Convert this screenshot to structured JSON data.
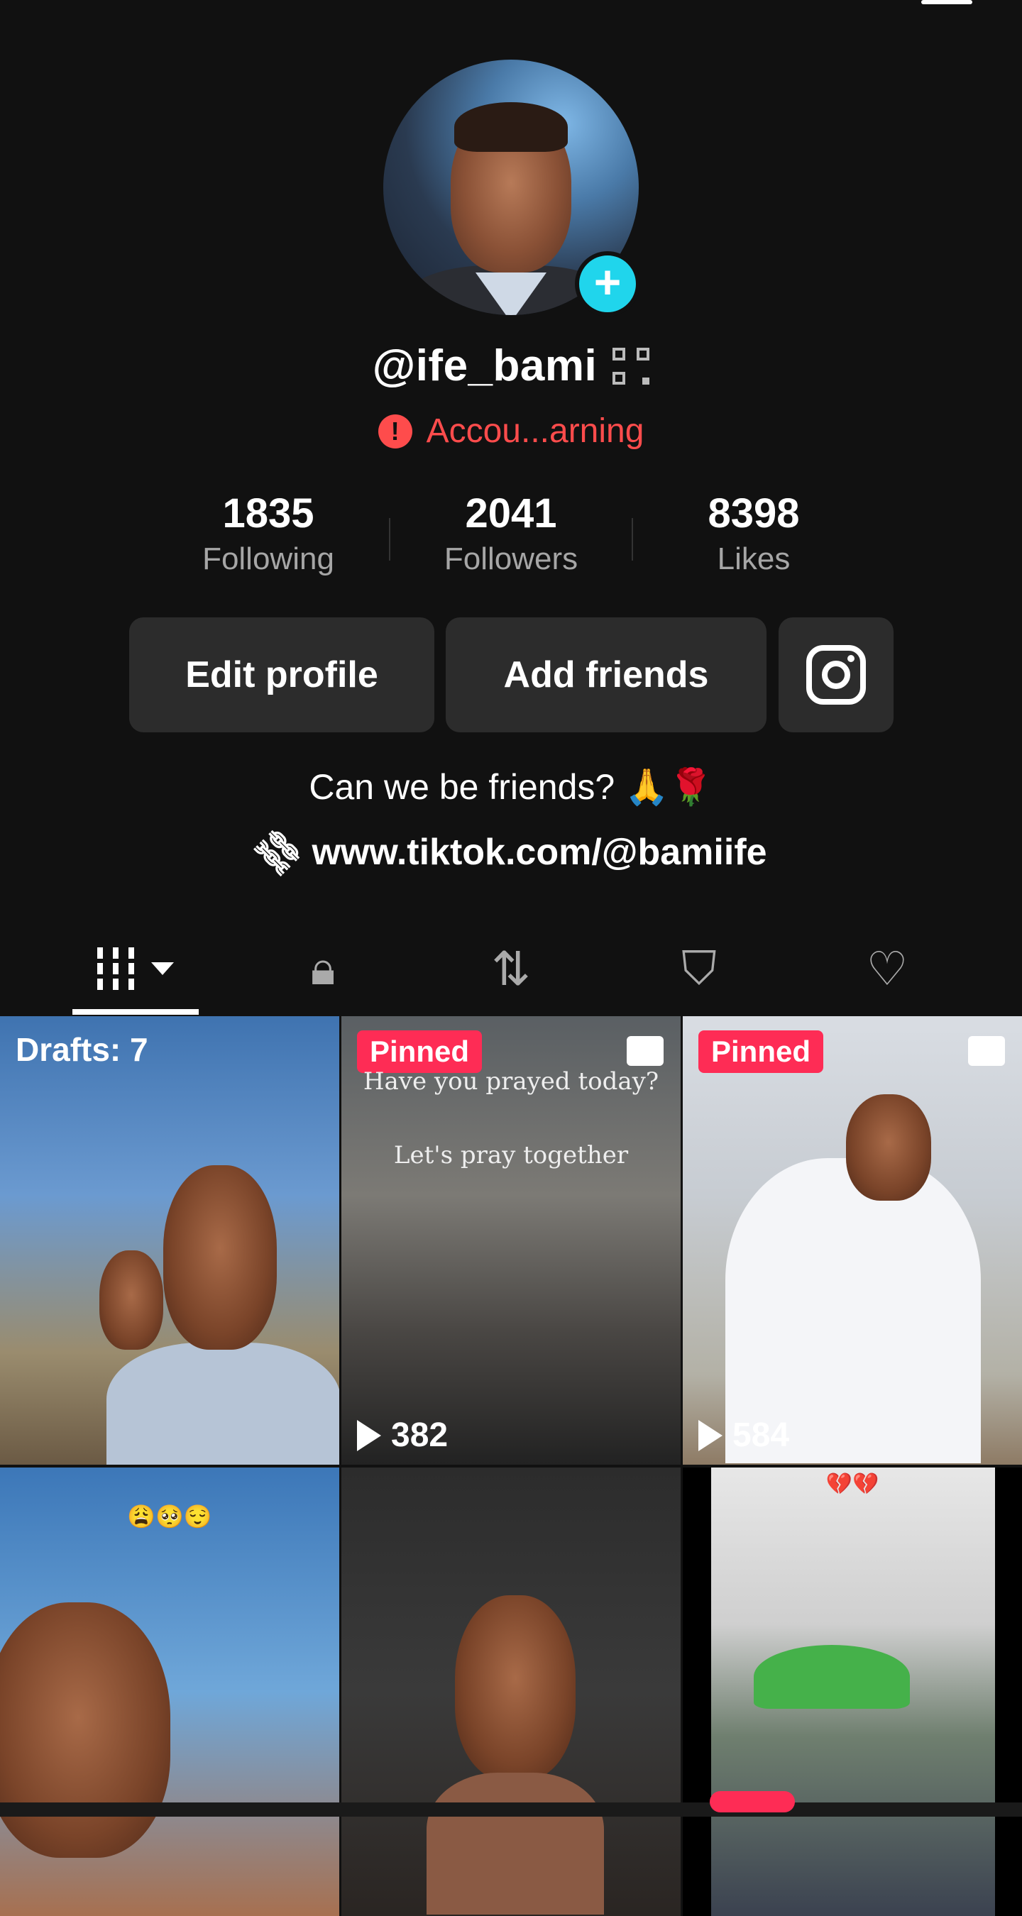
{
  "profile": {
    "username": "@ife_bami",
    "warning": "Accou...arning",
    "bio": "Can we be friends? 🙏🌹",
    "link": "www.tiktok.com/@bamiife"
  },
  "stats": [
    {
      "value": "1835",
      "label": "Following"
    },
    {
      "value": "2041",
      "label": "Followers"
    },
    {
      "value": "8398",
      "label": "Likes"
    }
  ],
  "buttons": {
    "edit_profile": "Edit profile",
    "add_friends": "Add friends"
  },
  "tabs": [
    {
      "icon": "videos-grid-icon"
    },
    {
      "icon": "lock-icon"
    },
    {
      "icon": "repost-icon"
    },
    {
      "icon": "hidden-tag-icon"
    },
    {
      "icon": "liked-hidden-icon"
    }
  ],
  "grid": {
    "drafts": "Drafts: 7",
    "pinned": "Pinned",
    "post2_text_1": "Have you prayed today?",
    "post2_text_2": "Let's pray together",
    "post2_views": "382",
    "post3_views": "584",
    "post4_emojis": "😩🥺😌",
    "post6_emojis": "💔💔"
  },
  "colors": {
    "accent_red": "#fe2c55",
    "warning": "#fe4c4c",
    "add_button": "#20d5ec",
    "background": "#111111"
  }
}
